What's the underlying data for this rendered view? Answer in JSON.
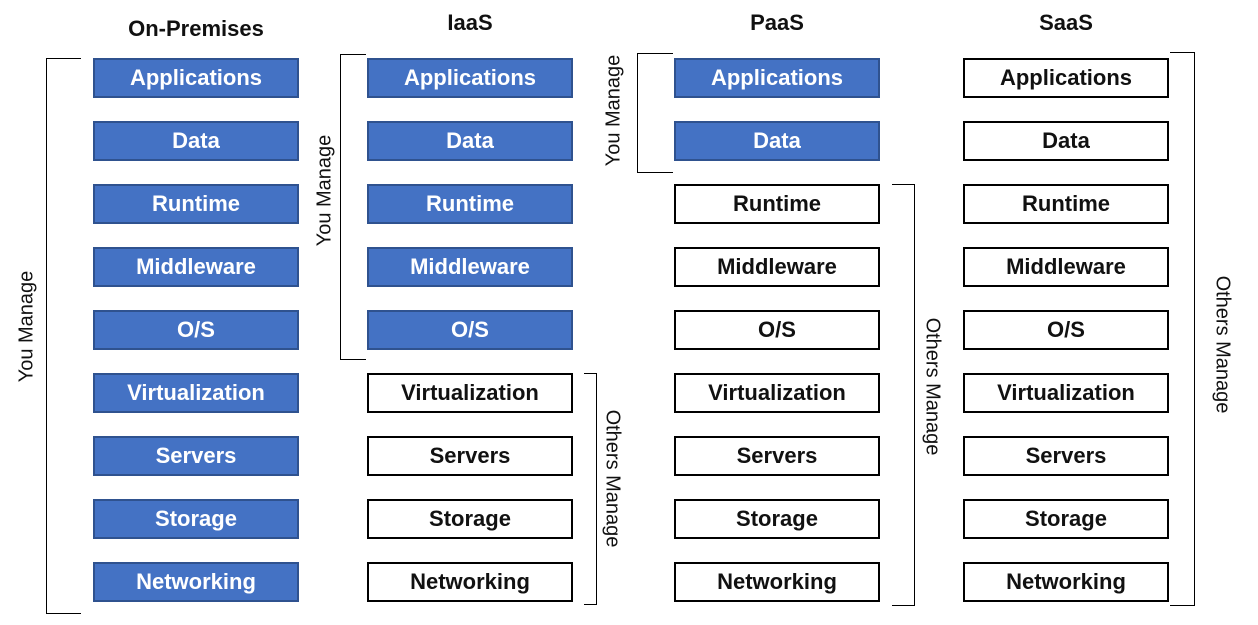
{
  "layers": [
    "Applications",
    "Data",
    "Runtime",
    "Middleware",
    "O/S",
    "Virtualization",
    "Servers",
    "Storage",
    "Networking"
  ],
  "columns": [
    {
      "title": "On-Premises",
      "you_manage_count": 9,
      "labels": {
        "you": "You Manage",
        "others": ""
      }
    },
    {
      "title": "IaaS",
      "you_manage_count": 5,
      "labels": {
        "you": "You Manage",
        "others": "Others Manage"
      }
    },
    {
      "title": "PaaS",
      "you_manage_count": 2,
      "labels": {
        "you": "You Manage",
        "others": "Others Manage"
      }
    },
    {
      "title": "SaaS",
      "you_manage_count": 0,
      "labels": {
        "you": "",
        "others": "Others Manage"
      }
    }
  ],
  "colors": {
    "you_manage": "#4472C4",
    "others_manage": "#FFFFFF"
  }
}
